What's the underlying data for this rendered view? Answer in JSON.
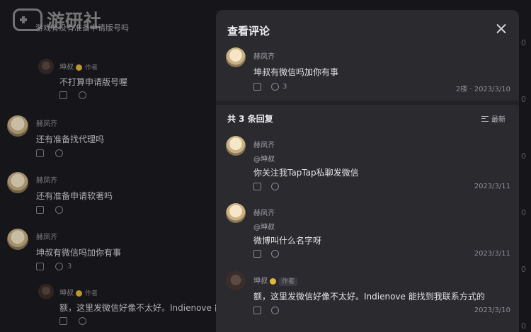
{
  "logo": {
    "text": "游研社"
  },
  "feed": {
    "top_text": "游戏有没有准备申请版号吗",
    "reply1": {
      "user": "坤叔",
      "tag": "作者",
      "text": "不打算申请版号喔"
    },
    "c1": {
      "user": "赫凤齐",
      "text": "还有准备找代理吗"
    },
    "c2": {
      "user": "赫凤齐",
      "text": "还有准备申请软著吗"
    },
    "c3": {
      "user": "赫凤齐",
      "text": "坤叔有微信吗加你有事",
      "replies": "3"
    },
    "reply2": {
      "user": "坤叔",
      "tag": "作者",
      "text": "额，这里发微信好像不太好。Indienove 能找"
    },
    "edge_zero": "0"
  },
  "panel": {
    "title": "查看评论",
    "main": {
      "user": "赫凤齐",
      "text": "坤叔有微信吗加你有事",
      "reply_count": "3",
      "meta": "2楼 · 2023/3/10"
    },
    "replies_title": "共 3 条回复",
    "sort_label": "最新",
    "replies": [
      {
        "user": "赫凤齐",
        "at": "@坤叔",
        "text": "你关注我TapTap私聊发微信",
        "date": "2023/3/11"
      },
      {
        "user": "赫凤齐",
        "at": "@坤叔",
        "text": "微博叫什么名字呀",
        "date": "2023/3/11"
      },
      {
        "user": "坤叔",
        "tag": "作者",
        "text": "额，这里发微信好像不太好。Indienove 能找到我联系方式的",
        "date": "2023/3/10"
      }
    ]
  }
}
